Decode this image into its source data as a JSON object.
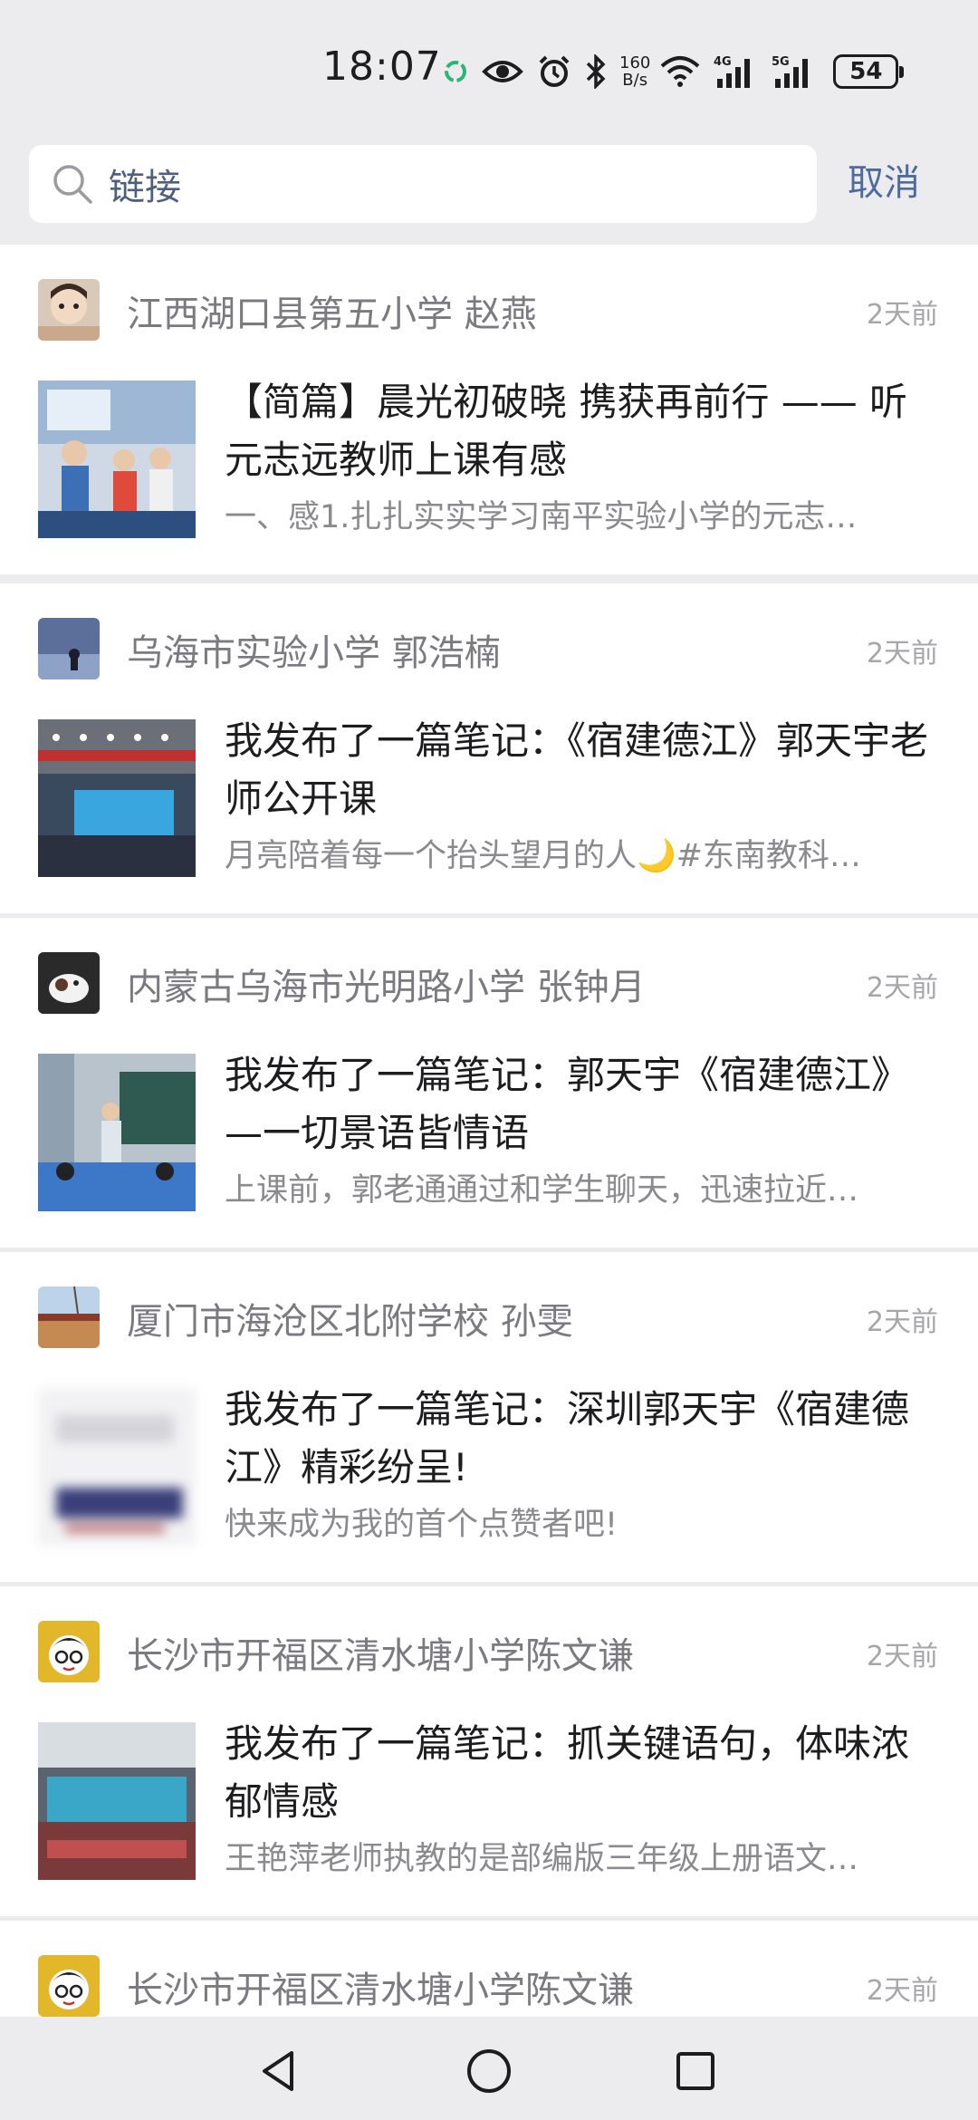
{
  "status_bar": {
    "time": "18:07",
    "network_speed_value": "160",
    "network_speed_unit": "B/s",
    "cell_1": "4G",
    "cell_2": "5G",
    "battery": "54"
  },
  "search": {
    "query": "链接",
    "cancel_label": "取消"
  },
  "colors": {
    "accent": "#4e6b9e",
    "page_background": "#ececef",
    "card_background": "#ffffff",
    "meta_text": "#a6a6ab"
  },
  "feed": [
    {
      "author": "江西湖口县第五小学 赵燕",
      "time": "2天前",
      "title": "【简篇】晨光初破晓 携获再前行 —— 听元志远教师上课有感",
      "desc": "一、感1.扎扎实实学习南平实验小学的元志…"
    },
    {
      "author": "乌海市实验小学 郭浩楠",
      "time": "2天前",
      "title": "我发布了一篇笔记：《宿建德江》郭天宇老师公开课",
      "desc": "月亮陪着每一个抬头望月的人🌙#东南教科…"
    },
    {
      "author": "内蒙古乌海市光明路小学 张钟月",
      "time": "2天前",
      "title": "我发布了一篇笔记：郭天宇《宿建德江》—一切景语皆情语",
      "desc": "上课前，郭老通通过和学生聊天，迅速拉近…"
    },
    {
      "author": "厦门市海沧区北附学校  孙雯",
      "time": "2天前",
      "title": "我发布了一篇笔记：深圳郭天宇《宿建德江》精彩纷呈!",
      "desc": "快来成为我的首个点赞者吧!"
    },
    {
      "author": "长沙市开福区清水塘小学陈文谦",
      "time": "2天前",
      "title": "我发布了一篇笔记：抓关键语句，体味浓郁情感",
      "desc": "王艳萍老师执教的是部编版三年级上册语文…"
    },
    {
      "author": "长沙市开福区清水塘小学陈文谦",
      "time": "2天前"
    }
  ],
  "icons": {
    "status": [
      "wechat-icon",
      "eye-icon",
      "alarm-icon",
      "bluetooth-icon",
      "wifi-icon",
      "signal-icon",
      "battery-icon"
    ],
    "search": "search-icon",
    "nav": [
      "back-icon",
      "home-icon",
      "recents-icon"
    ]
  }
}
